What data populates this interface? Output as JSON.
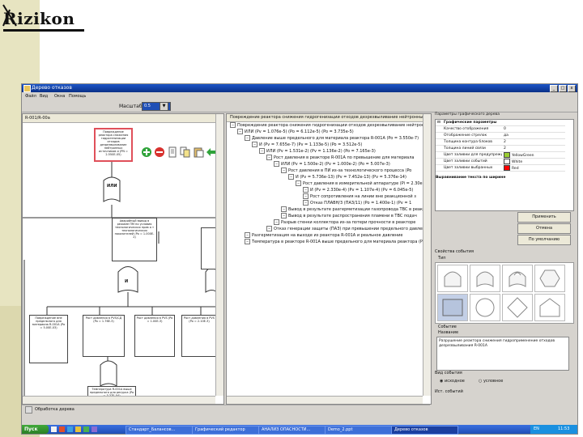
{
  "logo": {
    "text": "Rizikon"
  },
  "window": {
    "title": "Дерево отказов",
    "controls": [
      "_",
      "□",
      "x"
    ]
  },
  "menu": [
    "Файл",
    "Вид",
    "Окна",
    "Помощь"
  ],
  "zoom": {
    "label": "Масштаб",
    "value": "0.5"
  },
  "left_panel": {
    "title": "R-001/R-00a",
    "nodes": [
      {
        "text": "Повреждение реактора снижения гидрогенизации отходов дезрезвыливание нейтронных источников и (PN = 2.550E-05)"
      },
      {
        "text": "ИЛИ"
      },
      {
        "text": "Аварийный вывод в режиме ПМ по условия технологических прав о т технологических показателей (Po = 1.000E-2)"
      },
      {
        "text": "И"
      },
      {
        "text": "Повреждение вне предельного для материала R-001A (Po = 5.00E-03)"
      },
      {
        "text": "Рост давления в PVS/СД (Po = 1.76E-3)"
      },
      {
        "text": "Рост давления в PVS (Po = 1.00E-3)"
      },
      {
        "text": "Рост давления в PVS (Po = 2.10E-3)"
      },
      {
        "text": "Температура R-001A выше предельного для ресурса (Po = 3.37E-04)"
      }
    ]
  },
  "tree": {
    "header": "Повреждение реактора снижения гидрогенизации отходов дезрезвыливание нейтронных источников",
    "rows": [
      {
        "level": 0,
        "text": "Повреждение реактора снижения гидрогенизации отходов дезрезвыливание нейтронных истоков"
      },
      {
        "level": 1,
        "text": "ИЛИ (Pv = 1.076e-5) (Po = 6.112e-5) (Po = 3.735e-5)"
      },
      {
        "level": 2,
        "text": "Давление выше предельного для материала реактора R-001A (Po = 3.550e-7)"
      },
      {
        "level": 3,
        "text": "И (Pv = 7.655e-7) (Pv = 1.133e-5) (Po = 3.512e-5)"
      },
      {
        "level": 4,
        "text": "ИЛИ (Pv = 1.531e-2) (Pv = 1.136e-2) (Po = 7.165e-3)"
      },
      {
        "level": 5,
        "text": "Рост давления в реакторе R-001A по превышение для материала"
      },
      {
        "level": 6,
        "text": "ИЛИ (Pv = 1.500e-2) (Pv = 1.000e-2) (Po = 5.007e-3)"
      },
      {
        "level": 7,
        "text": "Рост давления в ПИ из-за технологического процесса (Po"
      },
      {
        "level": 8,
        "text": "И (Pv = 5.736e-13) (Pv = 7.452e-13) (Pv = 5.376e-14)"
      },
      {
        "level": 9,
        "text": "Рост давления в измерительной аппаратуре (Pi = 2.30e"
      },
      {
        "level": 10,
        "text": "И (Pv = 2.330e-4) (Pv = 1.107e-4) (Pv = 6.045e-5)"
      },
      {
        "level": 10,
        "text": "Рост сопротивления на линии вне реакционной з"
      },
      {
        "level": 10,
        "text": "Отказ ПЛАВН/3 (ПАЗ/11) (Po = 1.400e-1) (Pv = 1"
      },
      {
        "level": 7,
        "text": "Вывод в результате разгерметизации газопровода ТВС в реакторе"
      },
      {
        "level": 7,
        "text": "Вывод в результате распространения пламени в ТВС подач"
      },
      {
        "level": 6,
        "text": "Разрыв стенки коллектора из-за потери прочности в реакторе"
      },
      {
        "level": 5,
        "text": "Отказ генерации защиты (ПАЗ) при превышении предельного давления (P = 0.000e"
      },
      {
        "level": 2,
        "text": "Разгерметизация на выходе из реактора R-001A и реальное давление"
      },
      {
        "level": 2,
        "text": "Температура в реакторе R-001A выше предельного для материала реактора (Pv = 3.370e-4)"
      }
    ]
  },
  "properties": {
    "title": "Параметры графического дерева",
    "group": "Графические параметры",
    "rows": [
      {
        "key": "Качество отображения",
        "value": "0"
      },
      {
        "key": "Отображение стрелок",
        "value": "да"
      },
      {
        "key": "Толщина контура блоков",
        "value": "2"
      },
      {
        "key": "Толщина линий связи",
        "value": "2"
      },
      {
        "key": "Цвет заливки для предупреждений",
        "value": "YellowGreen",
        "color": "#9acd32"
      },
      {
        "key": "Цвет заливки событий",
        "value": "White",
        "color": "#ffffff"
      },
      {
        "key": "Цвет заливки выбранных",
        "value": "Red",
        "color": "#ff0000"
      }
    ],
    "note": "Выравнивание текста по ширине"
  },
  "buttons": {
    "apply": "Применить",
    "cancel": "Отмена",
    "default": "По умолчанию"
  },
  "event_props": {
    "title": "Свойства события",
    "type_label": "Тип",
    "event_label": "Событие",
    "name_label": "Название",
    "name_text": "Разрушение реактора снижения гидроприменение отходов дезрезвыливания R-001A",
    "kind_label": "Вид события",
    "kind_options": [
      "исходное",
      "условное"
    ],
    "source_label": "Ист. событий"
  },
  "status": {
    "text": "Обработка дерева"
  },
  "taskbar": {
    "start": "Пуск",
    "tasks": [
      "Стандарт_Балансов...",
      "Графический редактор",
      "АНАЛИЗ ОПАСНОСТИ...",
      "Demo_2.ppt",
      "Дерево отказов"
    ],
    "clock": "11:53",
    "lang": "EN"
  },
  "colors": {
    "accent": "#1f4fb6",
    "olive": "#e7e4c1"
  }
}
